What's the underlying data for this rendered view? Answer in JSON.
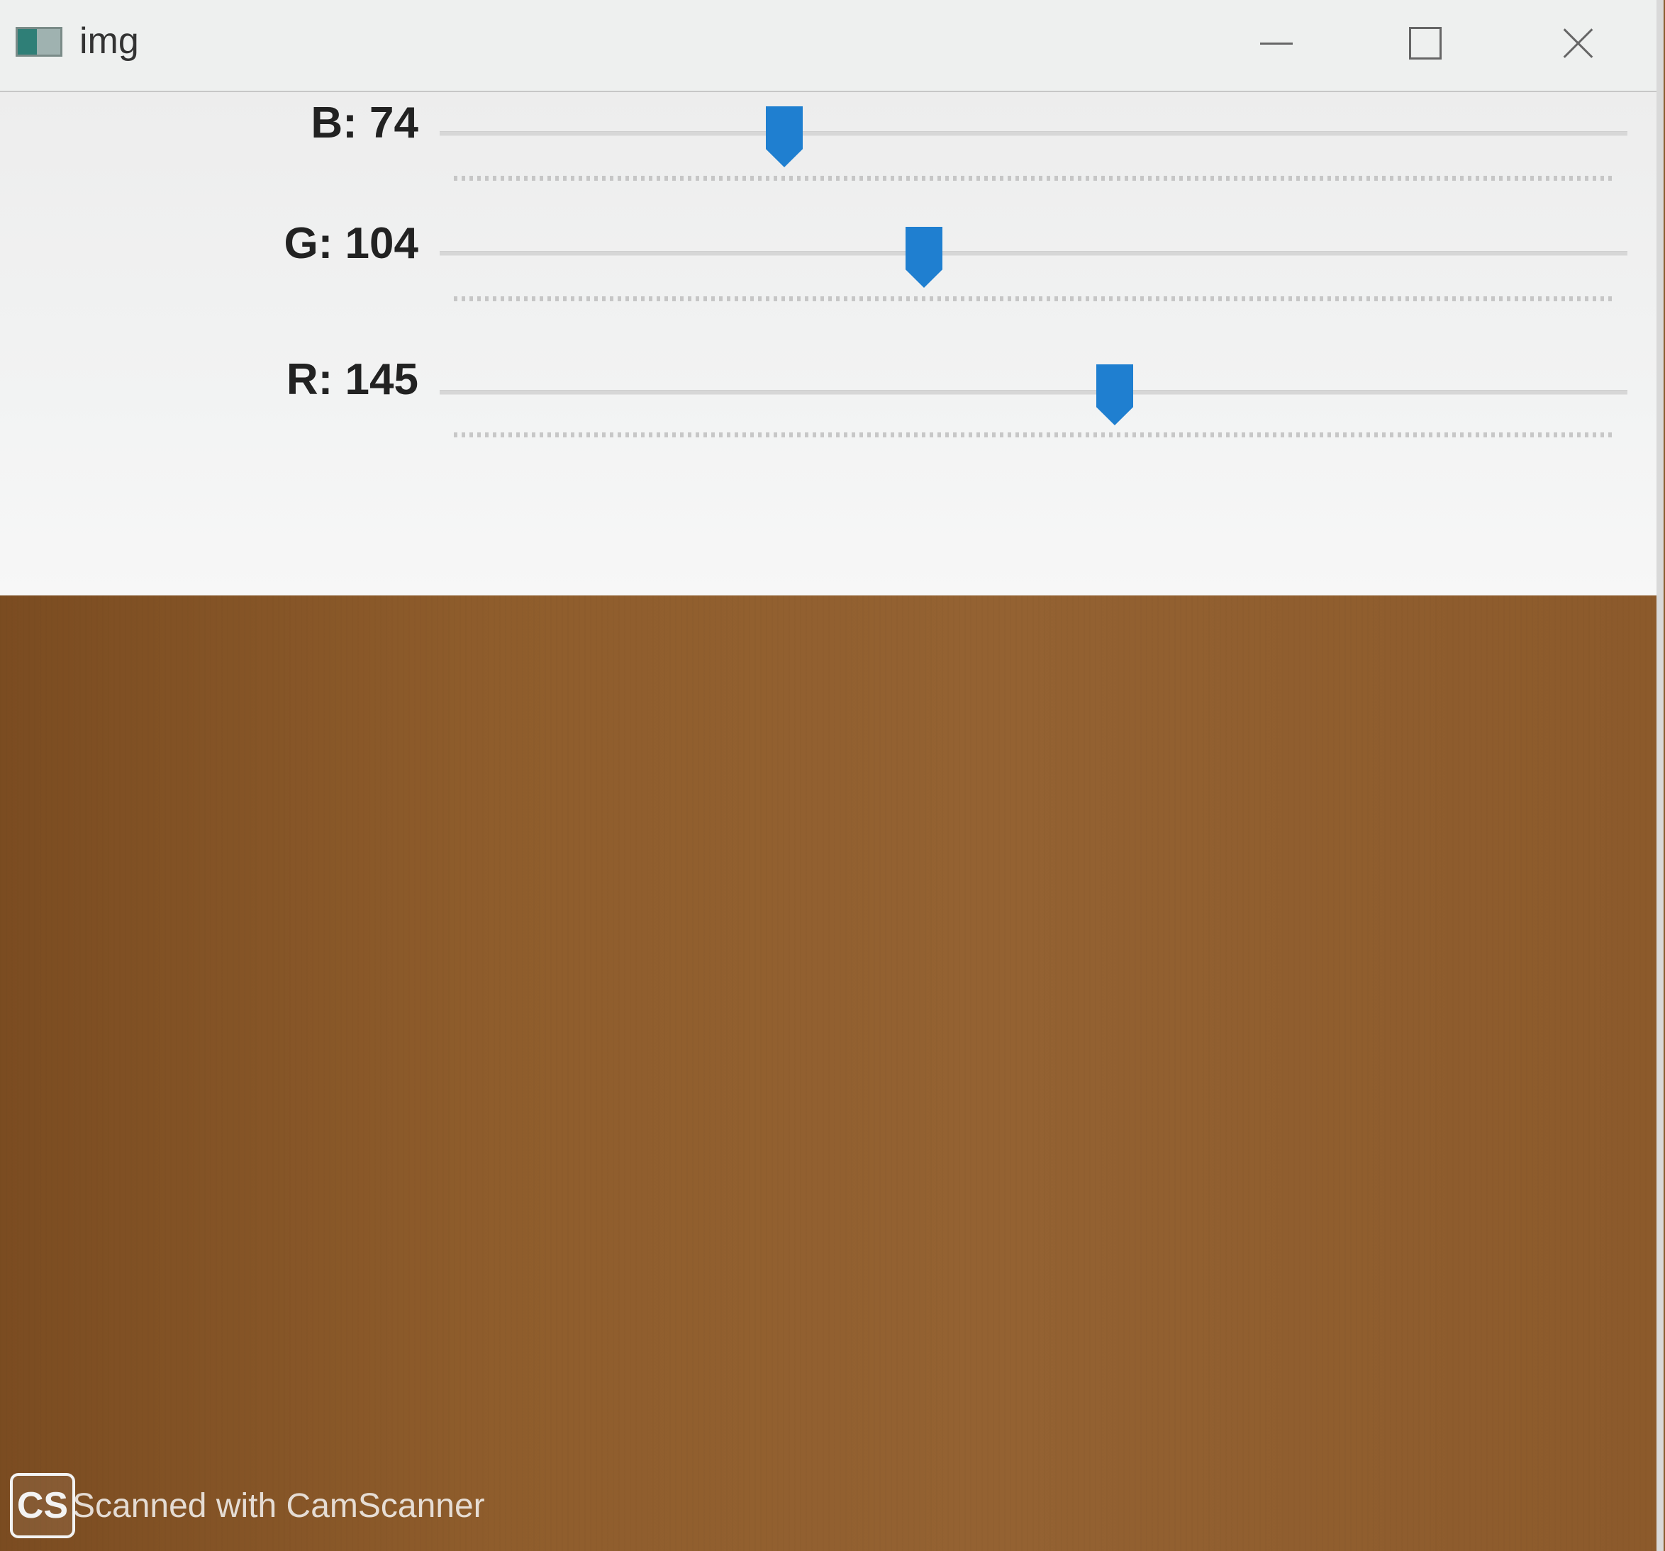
{
  "window": {
    "title": "img"
  },
  "controls": {
    "sliders": [
      {
        "name": "B",
        "label": "B: 74",
        "value": 74,
        "max": 255
      },
      {
        "name": "G",
        "label": "G: 104",
        "value": 104,
        "max": 255
      },
      {
        "name": "R",
        "label": "R: 145",
        "value": 145,
        "max": 255
      }
    ]
  },
  "image_preview": {
    "color": "#8f5d2c"
  },
  "watermark": {
    "logo": "CS",
    "text": "Scanned with CamScanner"
  },
  "icons": {
    "app": "image-window-icon",
    "minimize": "minimize-icon",
    "maximize": "maximize-icon",
    "close": "close-icon"
  }
}
